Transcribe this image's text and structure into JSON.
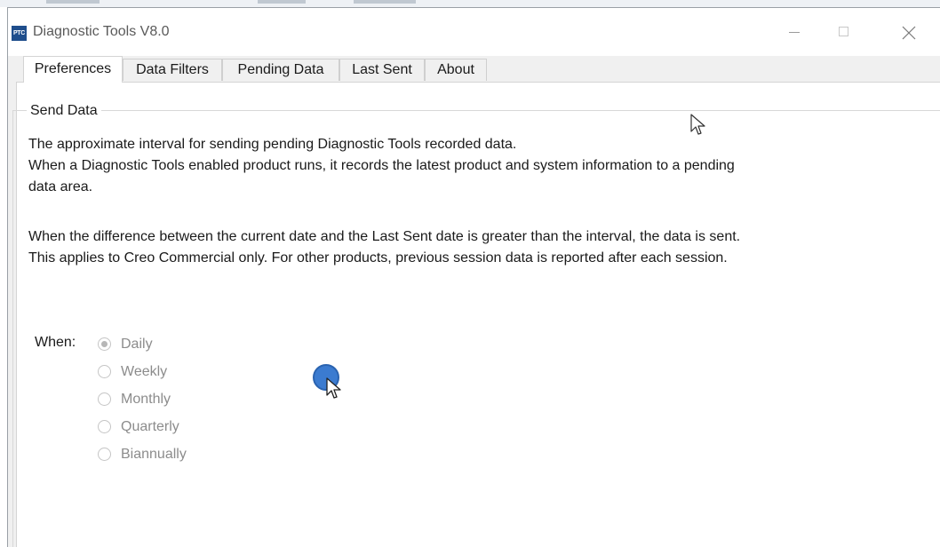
{
  "window": {
    "app_icon_text": "PTC",
    "title": "Diagnostic Tools V8.0"
  },
  "tabs": [
    {
      "label": "Preferences",
      "active": true
    },
    {
      "label": "Data Filters",
      "active": false
    },
    {
      "label": "Pending Data",
      "active": false
    },
    {
      "label": "Last Sent",
      "active": false
    },
    {
      "label": "About",
      "active": false
    }
  ],
  "send_data": {
    "legend": "Send Data",
    "lines": [
      "The approximate interval for sending pending Diagnostic Tools recorded data.",
      "When a Diagnostic Tools enabled product runs, it records the latest product and system information to a pending",
      "data area.",
      "When the difference between the current date and the Last Sent date is greater than the interval, the data is sent.",
      "This applies to Creo Commercial only. For other products, previous session data is reported after each session."
    ],
    "when_label": "When:",
    "options": [
      {
        "label": "Daily",
        "selected": true
      },
      {
        "label": "Weekly",
        "selected": false
      },
      {
        "label": "Monthly",
        "selected": false
      },
      {
        "label": "Quarterly",
        "selected": false
      },
      {
        "label": "Biannually",
        "selected": false
      }
    ],
    "options_enabled": false
  },
  "icons": {
    "app": "ptc-logo-icon",
    "minimize": "minimize-icon",
    "maximize": "maximize-icon",
    "close": "close-icon",
    "pointer": "mouse-pointer-icon",
    "click": "click-indicator-icon"
  },
  "colors": {
    "app_icon_bg": "#1f4e8c",
    "click_indicator": "#3b7bd0",
    "disabled_text": "#8c8c8c"
  }
}
